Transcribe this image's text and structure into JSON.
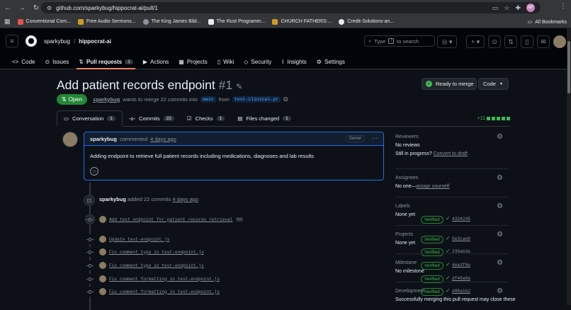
{
  "browser": {
    "url": "github.com/sparkybug/hippocrat-ai/pull/1",
    "profile_initials": "NF",
    "bookmarks": [
      {
        "label": "Conventional Com...",
        "color": "#e5534b"
      },
      {
        "label": "Free Audio Sermons...",
        "color": "#d29922"
      },
      {
        "label": "The King James Bibl...",
        "color": "#8b949e"
      },
      {
        "label": "The Rust Programm...",
        "color": "#e6edf3"
      },
      {
        "label": "CHURCH FATHERS:...",
        "color": "#d29922"
      },
      {
        "label": "Credit-Solutions-an...",
        "color": "#e6edf3"
      }
    ],
    "all_bookmarks": "All Bookmarks"
  },
  "header": {
    "owner": "sparkybug",
    "repo": "hippocrat-ai",
    "search_prefix": "Type",
    "search_key": "/",
    "search_suffix": "to search"
  },
  "repo_tabs": [
    {
      "label": "Code",
      "icon": "code-icon"
    },
    {
      "label": "Issues",
      "icon": "issue-icon"
    },
    {
      "label": "Pull requests",
      "icon": "pull-request-icon",
      "count": "1",
      "active": true
    },
    {
      "label": "Actions",
      "icon": "actions-icon"
    },
    {
      "label": "Projects",
      "icon": "projects-icon"
    },
    {
      "label": "Wiki",
      "icon": "wiki-icon"
    },
    {
      "label": "Security",
      "icon": "shield-icon"
    },
    {
      "label": "Insights",
      "icon": "graph-icon"
    },
    {
      "label": "Settings",
      "icon": "gear-icon"
    }
  ],
  "pr": {
    "title": "Add patient records endpoint",
    "number": "#1",
    "state": "Open",
    "author": "sparkybug",
    "merge_text": "wants to merge 22 commits into",
    "base_branch": "main",
    "from_text": "from",
    "head_branch": "test-clinical-pr",
    "ready_label": "Ready to merge",
    "code_label": "Code"
  },
  "pr_tabs": [
    {
      "label": "Conversation",
      "count": "1"
    },
    {
      "label": "Commits",
      "count": "22"
    },
    {
      "label": "Checks",
      "count": "1"
    },
    {
      "label": "Files changed",
      "count": "1"
    }
  ],
  "diffstat": "+11",
  "comment": {
    "author": "sparkybug",
    "action": "commented",
    "ago": "4 days ago",
    "badge": "Owner",
    "body": "Adding endpoint to retrieve full patient records including medications, diagnoses and lab results"
  },
  "commit_event": {
    "author": "sparkybug",
    "action": "added 22 commits",
    "ago": "4 days ago"
  },
  "commits": [
    {
      "message": "Add test endpoint for patient records retrieval",
      "verified": "Verified",
      "sha": "4334245"
    },
    {
      "message": "Update test-endpoint.js",
      "verified": "Verified",
      "sha": "5e3cae0"
    },
    {
      "message": "Fix comment typo in test-endpoint.js",
      "verified": "Verified",
      "sha": "239ab3e"
    },
    {
      "message": "Fix comment typo in test-endpoint.js",
      "verified": "Verified",
      "sha": "4ea3f6e"
    },
    {
      "message": "Fix comment formatting in test-endpoint.js",
      "verified": "Verified",
      "sha": "df40a8a"
    },
    {
      "message": "Fix comment formatting in test-endpoint.js",
      "verified": "Verified",
      "sha": "d88a1b2"
    }
  ],
  "sidebar": {
    "reviewers": {
      "title": "Reviewers",
      "value": "No reviews",
      "extra": "Still in progress?",
      "extra_link": "Convert to draft"
    },
    "assignees": {
      "title": "Assignees",
      "value": "No one—",
      "link": "assign yourself"
    },
    "labels": {
      "title": "Labels",
      "value": "None yet"
    },
    "projects": {
      "title": "Projects",
      "value": "None yet"
    },
    "milestone": {
      "title": "Milestone",
      "value": "No milestone"
    },
    "development": {
      "title": "Development",
      "value": "Successfully merging this pull request may close these"
    }
  }
}
